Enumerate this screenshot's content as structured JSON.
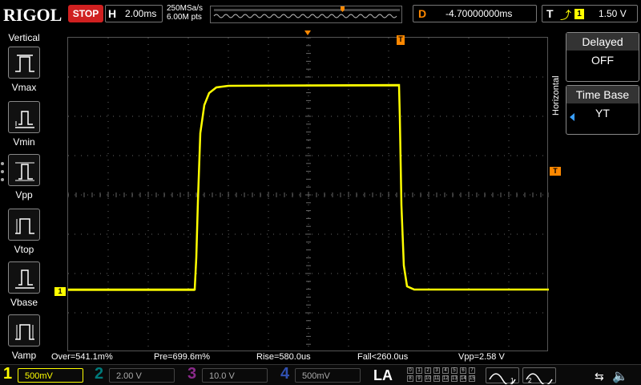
{
  "header": {
    "logo": "RIGOL",
    "run_status": "STOP",
    "horizontal_label": "H",
    "horizontal_scale": "2.00ms",
    "sample_rate": "250MSa/s",
    "memory_depth": "6.00M pts",
    "delay_label": "D",
    "delay_value": "-4.70000000ms",
    "trigger_label": "T",
    "trigger_channel": "1",
    "trigger_level": "1.50 V"
  },
  "left_menu": {
    "title": "Vertical",
    "items": [
      {
        "label": "Vmax",
        "icon": "vmax-icon"
      },
      {
        "label": "Vmin",
        "icon": "vmin-icon"
      },
      {
        "label": "Vpp",
        "icon": "vpp-icon"
      },
      {
        "label": "Vtop",
        "icon": "vtop-icon"
      },
      {
        "label": "Vbase",
        "icon": "vbase-icon"
      },
      {
        "label": "Vamp",
        "icon": "vamp-icon"
      }
    ]
  },
  "right_menu": {
    "section": "Horizontal",
    "delayed": {
      "title": "Delayed",
      "value": "OFF"
    },
    "timebase": {
      "title": "Time Base",
      "value": "YT"
    }
  },
  "markers": {
    "channel1": "1",
    "trigger": "T"
  },
  "measurements": {
    "over": "Over=541.1m%",
    "pre": "Pre=699.6m%",
    "rise": "Rise=580.0us",
    "fall": "Fall<260.0us",
    "vpp": "Vpp=2.58 V"
  },
  "channels": [
    {
      "num": "1",
      "scale": "500mV",
      "color": "#ffff00",
      "active": true
    },
    {
      "num": "2",
      "scale": "2.00 V",
      "color": "#00b0b0",
      "active": false
    },
    {
      "num": "3",
      "scale": "10.0 V",
      "color": "#c040c0",
      "active": false
    },
    {
      "num": "4",
      "scale": "500mV",
      "color": "#4060e0",
      "active": false
    }
  ],
  "logic_analyzer": {
    "label": "LA",
    "bits": [
      "0",
      "1",
      "2",
      "3",
      "4",
      "5",
      "6",
      "7",
      "8",
      "9",
      "10",
      "11",
      "12",
      "13",
      "14",
      "15"
    ]
  },
  "generators": [
    "1",
    "2"
  ],
  "colors": {
    "trace": "#ffff00",
    "trigger": "#ff8800",
    "grid": "#666666"
  }
}
